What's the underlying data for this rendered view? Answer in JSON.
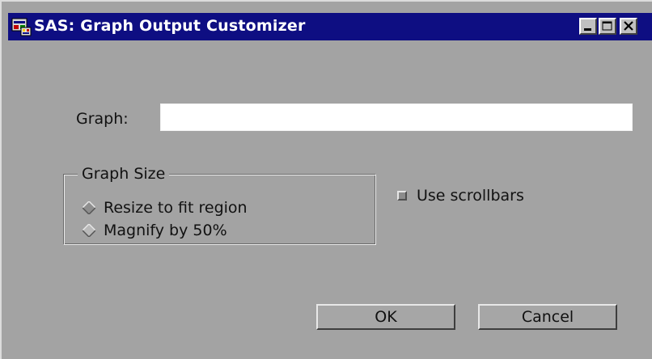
{
  "window": {
    "title": "SAS: Graph Output Customizer",
    "title_bar_color": "#0e0e82",
    "background_color": "#a3a3a3"
  },
  "graph_field": {
    "label": "Graph:",
    "value": ""
  },
  "graph_size": {
    "legend": "Graph Size",
    "options": [
      {
        "label": "Resize to fit region"
      },
      {
        "label": "Magnify by 50%"
      }
    ]
  },
  "scrollbars": {
    "label": "Use scrollbars",
    "checked": true
  },
  "buttons": {
    "ok": "OK",
    "cancel": "Cancel"
  },
  "icons": {
    "app": "sas-app-icon",
    "minimize": "minimize-icon",
    "maximize": "maximize-icon",
    "close": "close-icon"
  }
}
